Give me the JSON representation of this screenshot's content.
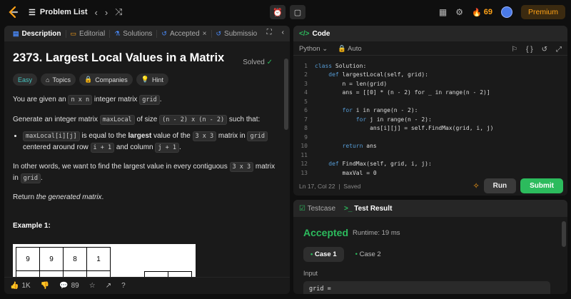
{
  "topbar": {
    "title": "Problem List",
    "prev": "‹",
    "next": "›",
    "shuffle": "⤨",
    "streak": "69",
    "premium": "Premium"
  },
  "tabs": [
    {
      "icon": "▤",
      "label": "Description"
    },
    {
      "icon": "▭",
      "label": "Editorial"
    },
    {
      "icon": "⚗",
      "label": "Solutions"
    },
    {
      "icon": "↺",
      "label": "Accepted"
    },
    {
      "icon": "↺",
      "label": "Submissio"
    }
  ],
  "problem": {
    "title": "2373. Largest Local Values in a Matrix",
    "solved": "Solved",
    "chips": [
      "Easy",
      "Topics",
      "Companies",
      "Hint"
    ],
    "p1a": "You are given an ",
    "p1c1": "n x n",
    "p1b": " integer matrix ",
    "p1c2": "grid",
    "p1d": ".",
    "p2a": "Generate an integer matrix ",
    "p2c1": "maxLocal",
    "p2b": " of size ",
    "p2c2": "(n - 2) x (n - 2)",
    "p2d": " such that:",
    "b1c1": "maxLocal[i][j]",
    "b1a": " is equal to the ",
    "b1b": "largest",
    "b1c": " value of the ",
    "b1c2": "3 x 3",
    "b1d": " matrix in ",
    "b1c3": "grid",
    "b1e": " centered around row ",
    "b1c4": "i + 1",
    "b1f": " and column ",
    "b1c5": "j + 1",
    "b1g": ".",
    "p3a": "In other words, we want to find the largest value in every contiguous ",
    "p3c": "3 x 3",
    "p3b": " matrix in ",
    "p3c2": "grid",
    "p3d": ".",
    "p4a": "Return ",
    "p4b": "the generated matrix",
    "p4c": ".",
    "example": "Example 1:",
    "grid_row": [
      "9",
      "9",
      "8",
      "1"
    ]
  },
  "footer": {
    "likes": "1K",
    "comments": "89"
  },
  "code": {
    "header": "Code",
    "lang": "Python",
    "auto": "Auto",
    "status": "Ln 17, Col 22",
    "saved": "Saved",
    "lines": [
      {
        "n": "1",
        "t": "class Solution:"
      },
      {
        "n": "2",
        "t": "    def largestLocal(self, grid):"
      },
      {
        "n": "3",
        "t": "        n = len(grid)"
      },
      {
        "n": "4",
        "t": "        ans = [[0] * (n - 2) for _ in range(n - 2)]"
      },
      {
        "n": "5",
        "t": ""
      },
      {
        "n": "6",
        "t": "        for i in range(n - 2):"
      },
      {
        "n": "7",
        "t": "            for j in range(n - 2):"
      },
      {
        "n": "8",
        "t": "                ans[i][j] = self.FindMax(grid, i, j)"
      },
      {
        "n": "9",
        "t": ""
      },
      {
        "n": "10",
        "t": "        return ans"
      },
      {
        "n": "11",
        "t": ""
      },
      {
        "n": "12",
        "t": "    def FindMax(self, grid, i, j):"
      },
      {
        "n": "13",
        "t": "        maxVal = 0"
      }
    ],
    "run": "Run",
    "submit": "Submit"
  },
  "test": {
    "tab1": "Testcase",
    "tab2": "Test Result",
    "accepted": "Accepted",
    "runtime": "Runtime: 19 ms",
    "case1": "Case 1",
    "case2": "Case 2",
    "input_label": "Input",
    "input_val": "grid ="
  }
}
